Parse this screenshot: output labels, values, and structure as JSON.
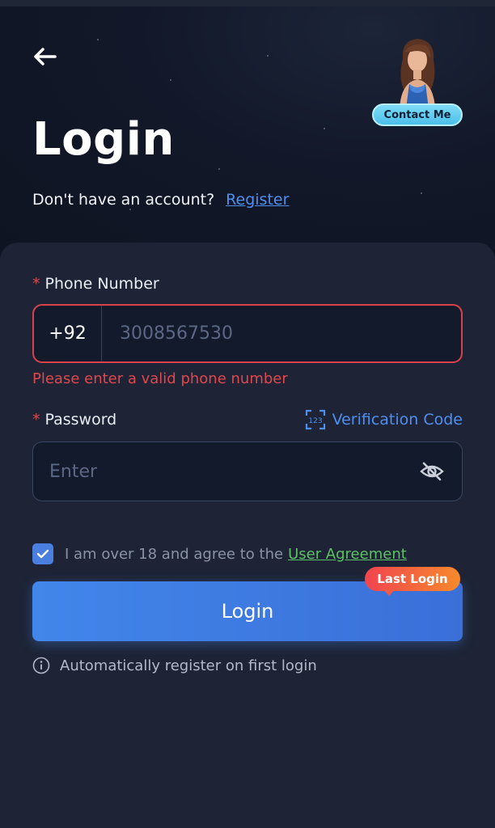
{
  "header": {
    "back_icon": "arrow-left-icon",
    "title": "Login",
    "contact_label": "Contact Me",
    "register_prompt": "Don't have an account?",
    "register_link": "Register"
  },
  "form": {
    "required_mark": "*",
    "phone": {
      "label": "Phone Number",
      "country_code": "+92",
      "placeholder": "3008567530",
      "value": "",
      "error": "Please enter a valid phone number"
    },
    "password": {
      "label": "Password",
      "verification_link": "Verification Code",
      "verification_icon_text": "123",
      "placeholder": "Enter",
      "value": "",
      "toggle_icon": "eye-off-icon"
    },
    "agreement": {
      "checked": true,
      "text": "I am over 18 and agree to the",
      "link": "User Agreement"
    },
    "submit_label": "Login",
    "last_login_badge": "Last Login",
    "auto_register_note": "Automatically register on first login"
  },
  "colors": {
    "background": "#0f1422",
    "card": "#1e2436",
    "accent_blue": "#4f8ff0",
    "error_red": "#e0474c",
    "agreement_green": "#5cc166",
    "badge_orange": "#f78a2c"
  }
}
